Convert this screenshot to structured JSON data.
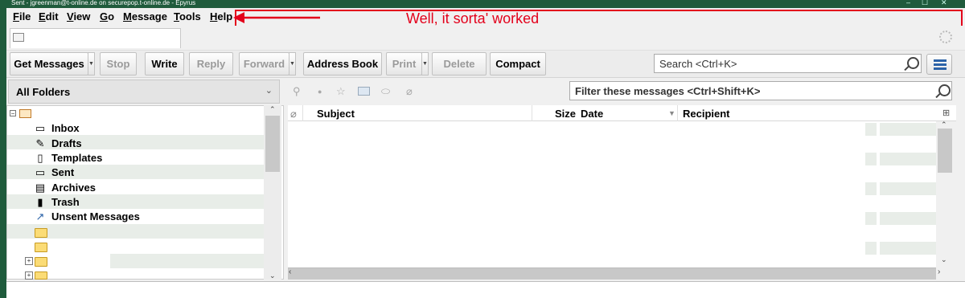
{
  "window": {
    "title": "Sent - jgreenman@t-online.de on securepop.t-online.de - Epyrus",
    "controls": [
      "–",
      "☐",
      "✕"
    ]
  },
  "menubar": {
    "items": [
      {
        "label": "File",
        "key": "F",
        "rest": "ile"
      },
      {
        "label": "Edit",
        "key": "E",
        "rest": "dit"
      },
      {
        "label": "View",
        "key": "V",
        "rest": "iew"
      },
      {
        "label": "Go",
        "key": "G",
        "rest": "o"
      },
      {
        "label": "Message",
        "key": "M",
        "rest": "essage"
      },
      {
        "label": "Tools",
        "key": "T",
        "rest": "ools"
      },
      {
        "label": "Help",
        "key": "H",
        "rest": "elp"
      }
    ]
  },
  "annotation": {
    "text": "Well, it sorta' worked",
    "color": "#e3001b"
  },
  "toolbar": {
    "get_messages": "Get Messages",
    "stop": "Stop",
    "write": "Write",
    "reply": "Reply",
    "forward": "Forward",
    "address_book": "Address Book",
    "print": "Print",
    "delete": "Delete",
    "compact": "Compact",
    "search_placeholder": "Search <Ctrl+K>"
  },
  "folder_pane": {
    "header": "All Folders",
    "folders": [
      {
        "name": "Inbox",
        "icon": "inbox-icon",
        "glyph": "▭"
      },
      {
        "name": "Drafts",
        "icon": "drafts-icon",
        "glyph": "✎"
      },
      {
        "name": "Templates",
        "icon": "templates-icon",
        "glyph": "▯"
      },
      {
        "name": "Sent",
        "icon": "sent-icon",
        "glyph": "▭"
      },
      {
        "name": "Archives",
        "icon": "archives-icon",
        "glyph": "▤"
      },
      {
        "name": "Trash",
        "icon": "trash-icon",
        "glyph": "▮"
      },
      {
        "name": "Unsent Messages",
        "icon": "unsent-icon",
        "glyph": "↗"
      }
    ]
  },
  "quick_filter": {
    "placeholder": "Filter these messages <Ctrl+Shift+K>"
  },
  "thread_columns": {
    "subject": "Subject",
    "size": "Size",
    "date": "Date",
    "recipient": "Recipient"
  },
  "colors": {
    "accent": "#2c63a8",
    "titlebar": "#1f5b3c"
  }
}
